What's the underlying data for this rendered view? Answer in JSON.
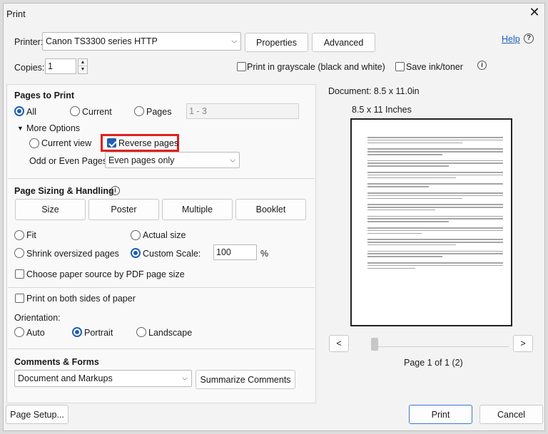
{
  "window": {
    "title": "Print",
    "close_glyph": "✕"
  },
  "printer": {
    "label": "Printer:",
    "selected": "Canon TS3300 series HTTP",
    "properties_label": "Properties",
    "advanced_label": "Advanced",
    "help_label": "Help"
  },
  "copies": {
    "label": "Copies:",
    "value": "1",
    "grayscale_label": "Print in grayscale (black and white)",
    "grayscale_checked": false,
    "save_ink_label": "Save ink/toner",
    "save_ink_checked": false
  },
  "pages_to_print": {
    "title": "Pages to Print",
    "options": [
      "All",
      "Current",
      "Pages"
    ],
    "selected": "All",
    "pages_range_placeholder": "1 - 3",
    "more_options_label": "More Options",
    "current_view_label": "Current view",
    "reverse_pages_label": "Reverse pages",
    "reverse_pages_checked": true,
    "odd_even_label": "Odd or Even Pages:",
    "odd_even_value": "Even pages only"
  },
  "page_sizing": {
    "title": "Page Sizing & Handling",
    "buttons": [
      "Size",
      "Poster",
      "Multiple",
      "Booklet"
    ],
    "fit_label": "Fit",
    "actual_size_label": "Actual size",
    "shrink_label": "Shrink oversized pages",
    "custom_scale_label": "Custom Scale:",
    "custom_scale_value": "100",
    "percent_sign": "%",
    "selected": "Custom Scale:",
    "paper_source_label": "Choose paper source by PDF page size"
  },
  "duplex": {
    "label": "Print on both sides of paper"
  },
  "orientation": {
    "label": "Orientation:",
    "options": [
      "Auto",
      "Portrait",
      "Landscape"
    ],
    "selected": "Portrait"
  },
  "comments_forms": {
    "title": "Comments & Forms",
    "selected": "Document and Markups",
    "summarize_label": "Summarize Comments"
  },
  "preview": {
    "document_size": "Document: 8.5 x 11.0in",
    "paper_size": "8.5 x 11 Inches",
    "prev_label": "<",
    "next_label": ">",
    "page_indicator": "Page 1 of 1 (2)"
  },
  "footer": {
    "page_setup_label": "Page Setup...",
    "print_label": "Print",
    "cancel_label": "Cancel"
  },
  "colors": {
    "accent": "#1f5fb4",
    "highlight": "#e0201c"
  },
  "icons": [
    "close-icon",
    "help-icon",
    "info-icon",
    "chevron-down-icon",
    "triangle-down-icon",
    "checkmark-icon"
  ]
}
